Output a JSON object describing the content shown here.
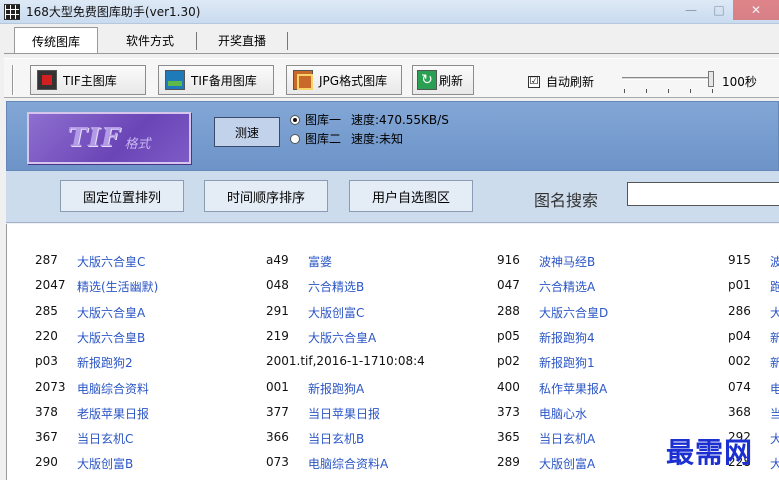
{
  "window": {
    "title": "168大型免费图库助手(ver1.30)",
    "buttons": [
      "—",
      "□",
      "✕"
    ]
  },
  "tabs": [
    {
      "label": "传统图库",
      "active": true
    },
    {
      "label": "软件方式",
      "active": false
    },
    {
      "label": "开奖直播",
      "active": false
    }
  ],
  "toolbar": {
    "tif_main": "TIF主图库",
    "tif_backup": "TIF备用图库",
    "jpg": "JPG格式图库",
    "refresh": "刷新",
    "auto_refresh": "自动刷新",
    "auto_refresh_checked": true,
    "check_mark": "☑",
    "slider_fraction": 1.0,
    "interval": "100秒"
  },
  "panel": {
    "logo_big": "TIF",
    "logo_small": "格式",
    "speed_test": "测速",
    "lib1": {
      "label": "图库一",
      "speed": "速度:470.55KB/S",
      "selected": true
    },
    "lib2": {
      "label": "图库二",
      "speed": "速度:未知",
      "selected": false
    }
  },
  "band": {
    "sort_fixed": "固定位置排列",
    "sort_time": "时间顺序排序",
    "user_select": "用户自选图区",
    "search_label": "图名搜索",
    "search_value": ""
  },
  "rows": [
    [
      {
        "code": "287",
        "name": "大版六合皇C"
      },
      {
        "code": "a49",
        "name": "富婆"
      },
      {
        "code": "916",
        "name": "波神马经B"
      },
      {
        "code": "915",
        "name": "波"
      }
    ],
    [
      {
        "code": "2047",
        "name": "精选(生活幽默)"
      },
      {
        "code": "048",
        "name": "六合精选B"
      },
      {
        "code": "047",
        "name": "六合精选A"
      },
      {
        "code": "p01",
        "name": "跑"
      }
    ],
    [
      {
        "code": "285",
        "name": "大版六合皇A"
      },
      {
        "code": "291",
        "name": "大版创富C"
      },
      {
        "code": "288",
        "name": "大版六合皇D"
      },
      {
        "code": "286",
        "name": "大"
      }
    ],
    [
      {
        "code": "220",
        "name": "大版六合皇B"
      },
      {
        "code": "219",
        "name": "大版六合皇A"
      },
      {
        "code": "p05",
        "name": "新报跑狗4"
      },
      {
        "code": "p04",
        "name": "新"
      }
    ],
    [
      {
        "code": "p03",
        "name": "新报跑狗2"
      },
      {
        "code": "2001.tif,2016-1-1710:08:4",
        "name": ""
      },
      {
        "code": "p02",
        "name": "新报跑狗1"
      },
      {
        "code": "002",
        "name": "新"
      }
    ],
    [
      {
        "code": "2073",
        "name": "电脑综合资料"
      },
      {
        "code": "001",
        "name": "新报跑狗A"
      },
      {
        "code": "400",
        "name": "私作苹果报A"
      },
      {
        "code": "074",
        "name": "电"
      }
    ],
    [
      {
        "code": "378",
        "name": "老版苹果日报"
      },
      {
        "code": "377",
        "name": "当日苹果日报"
      },
      {
        "code": "373",
        "name": "电脑心水"
      },
      {
        "code": "368",
        "name": "当"
      }
    ],
    [
      {
        "code": "367",
        "name": "当日玄机C"
      },
      {
        "code": "366",
        "name": "当日玄机B"
      },
      {
        "code": "365",
        "name": "当日玄机A"
      },
      {
        "code": "292",
        "name": "大"
      }
    ],
    [
      {
        "code": "290",
        "name": "大版创富B"
      },
      {
        "code": "073",
        "name": "电脑综合资料A"
      },
      {
        "code": "289",
        "name": "大版创富A"
      },
      {
        "code": "228",
        "name": "大"
      }
    ]
  ],
  "watermark": "最需网"
}
